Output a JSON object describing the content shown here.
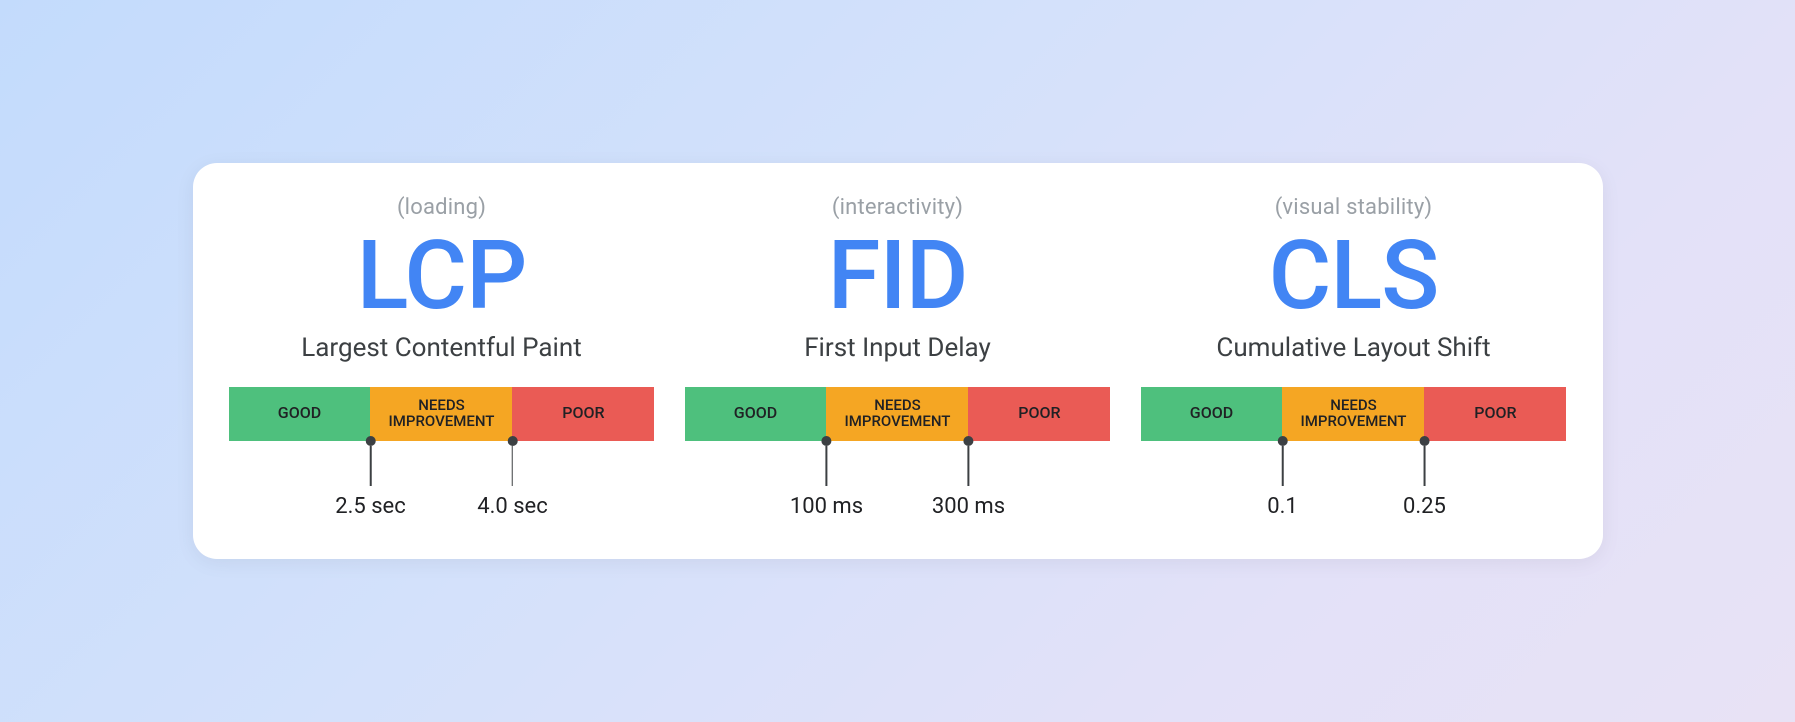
{
  "metrics": [
    {
      "category": "(loading)",
      "abbr": "LCP",
      "fullname": "Largest Contentful Paint",
      "bar": {
        "good": "GOOD",
        "needs_l1": "NEEDS",
        "needs_l2": "IMPROVEMENT",
        "poor": "POOR"
      },
      "thresholds": {
        "t1": "2.5 sec",
        "t2": "4.0 sec"
      }
    },
    {
      "category": "(interactivity)",
      "abbr": "FID",
      "fullname": "First Input Delay",
      "bar": {
        "good": "GOOD",
        "needs_l1": "NEEDS",
        "needs_l2": "IMPROVEMENT",
        "poor": "POOR"
      },
      "thresholds": {
        "t1": "100 ms",
        "t2": "300 ms"
      }
    },
    {
      "category": "(visual stability)",
      "abbr": "CLS",
      "fullname": "Cumulative Layout Shift",
      "bar": {
        "good": "GOOD",
        "needs_l1": "NEEDS",
        "needs_l2": "IMPROVEMENT",
        "poor": "POOR"
      },
      "thresholds": {
        "t1": "0.1",
        "t2": "0.25"
      }
    }
  ],
  "colors": {
    "good": "#4ec07d",
    "needs": "#f5a623",
    "poor": "#ea5b55",
    "accent": "#4285f4"
  }
}
